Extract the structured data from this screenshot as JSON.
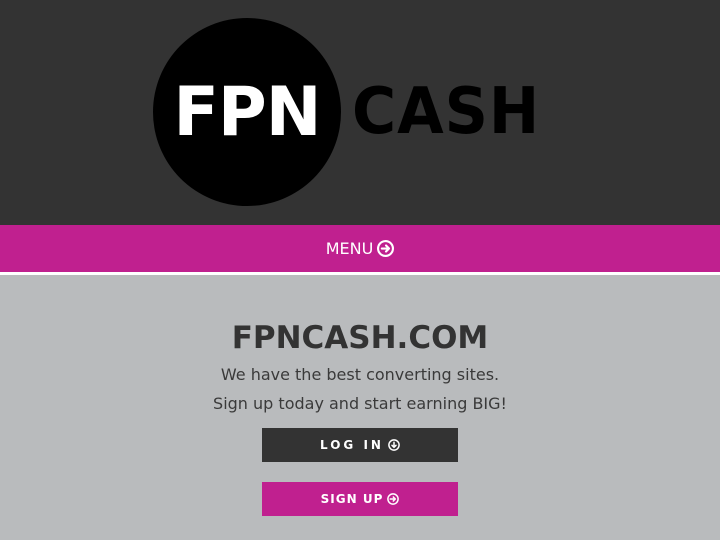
{
  "logo": {
    "circle_text": "FPN",
    "side_text": "CASH"
  },
  "nav": {
    "menu_label": "MENU",
    "menu_icon": "circle-arrow-right-icon"
  },
  "main": {
    "title": "FPNCASH.COM",
    "tagline_1": "We have the best converting sites.",
    "tagline_2": "Sign up today and start earning BIG!",
    "login_label": "LOG IN",
    "login_icon": "circle-arrow-down-icon",
    "signup_label": "SIGN UP",
    "signup_icon": "circle-arrow-right-icon"
  },
  "colors": {
    "header_bg": "#333333",
    "accent_magenta": "#c0208f",
    "content_bg": "#b9bbbd",
    "dark_button": "#333333"
  }
}
